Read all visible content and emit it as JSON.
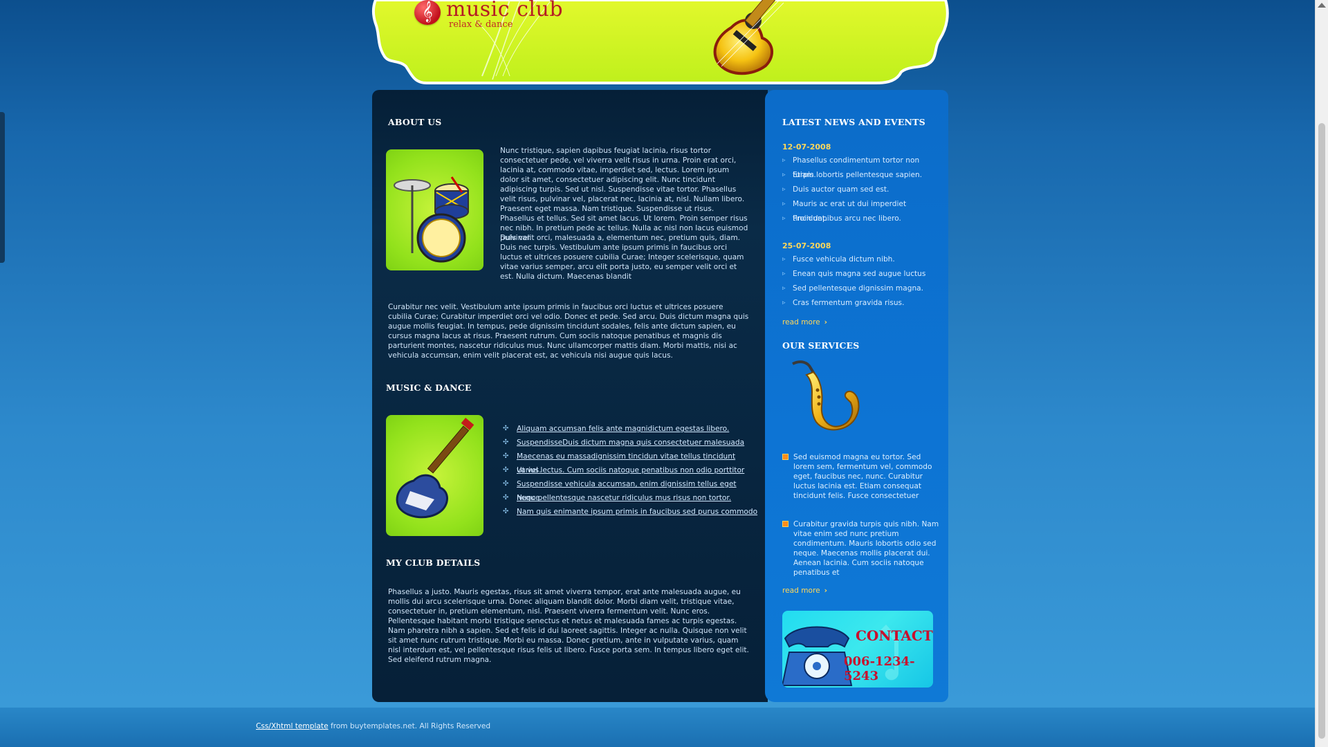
{
  "header": {
    "logo_glyph": "𝄞",
    "title": "music club",
    "tagline": "relax & dance"
  },
  "about": {
    "heading": "ABOUT US",
    "para1": "Nunc tristique, sapien dapibus feugiat lacinia, risus tortor consectetuer pede, vel viverra velit risus in urna. Proin erat orci, lacinia at, commodo vitae, imperdiet sed, lectus. Lorem ipsum dolor sit amet, consectetuer adipiscing elit. Nunc tincidunt adipiscing turpis. Sed ut nisl. Suspendisse vitae tortor. Phasellus velit risus, pulvinar vel, placerat nec, lacinia at, nisl. Nullam libero. Praesent eget massa. Nam tristique. Suspendisse ut risus. Phasellus et tellus. Sed sit amet lacus. Ut lorem. Proin semper risus nec nibh. In pretium pede ac tellus. Nulla ac nisl non lacus euismod pulvinar.",
    "para2": "Duis velit orci, malesuada a, elementum nec, pretium quis, diam. Duis nec turpis. Vestibulum ante ipsum primis in faucibus orci luctus et ultrices posuere cubilia Curae; Integer scelerisque, quam vitae varius semper, arcu elit porta justo, eu semper velit orci et est. Nulla dictum. Maecenas blandit",
    "para3": "Curabitur nec velit. Vestibulum ante ipsum primis in faucibus orci luctus et ultrices posuere cubilia Curae; Curabitur imperdiet orci vel odio. Donec et pede. Sed arcu. Duis dictum magna quis augue mollis feugiat. In tempus, pede dignissim tincidunt sodales, felis ante dictum sapien, eu cursus magna lacus at risus. Praesent rutrum. Cum sociis natoque penatibus et magnis dis parturient montes, nascetur ridiculus mus. Nunc ullamcorper mattis diam. Morbi mattis, nisi ac vehicula accumsan, enim velit placerat est, ac vehicula nisi augue quis lacus."
  },
  "music_dance": {
    "heading": "MUSIC & DANCE",
    "links": [
      "Aliquam accumsan felis ante magnidictum egestas libero.",
      "SuspendisseDuis dictum magna quis consectetuer malesuada",
      "Maecenas eu massadignissim tincidun vitae tellus tincidunt varius.",
      "Ut vel lectus. Cum sociis natoque penatibus non odio porttitor",
      "Suspendisse vehicula accumsan, enim dignissim tellus eget neque.",
      "Nunc pellentesque nascetur ridiculus mus risus non tortor.",
      "Nam quis enimante ipsum primis in faucibus sed purus commodo"
    ]
  },
  "club_details": {
    "heading": "MY CLUB DETAILS",
    "para": "Phasellus a justo. Mauris egestas, risus sit amet viverra tempor, erat ante malesuada augue, eu mollis dui arcu scelerisque urna. Donec aliquam blandit dolor. Morbi diam velit, tristique vitae, consectetuer in, pretium elementum, nisl. Praesent viverra fermentum velit. Nunc eros. Pellentesque habitant morbi tristique senectus et netus et malesuada fames ac turpis egestas. Nam pharetra nibh a sapien. Sed et felis id dui laoreet sagittis. Integer ac nulla. Quisque non velit sit amet nunc rutrum tristique. Morbi eu massa. Donec pretium, ante in vulputate varius, quam nisl interdum est, vel pellentesque risus felis ut libero. Fusce porta sem. In tempus libero eget elit. Sed eleifend rutrum magna."
  },
  "news": {
    "heading": "LATEST NEWS AND EVENTS",
    "groups": [
      {
        "date": "12-07-2008",
        "items": [
          "Phasellus condimentum tortor non turpis.",
          "Etiam lobortis pellentesque sapien.",
          "Duis auctor quam sed est.",
          "Mauris ac erat ut dui imperdiet tincidunt.",
          "Proin dapibus arcu nec libero."
        ]
      },
      {
        "date": "25-07-2008",
        "items": [
          "Fusce vehicula dictum nibh.",
          "Enean quis magna sed augue luctus",
          "Sed pellentesque dignissim magna.",
          "Cras fermentum gravida risus."
        ]
      }
    ],
    "read_more": "read more"
  },
  "services": {
    "heading": "OUR SERVICES",
    "items": [
      "Sed euismod magna eu tortor. Sed lorem sem, fermentum vel, commodo eget, faucibus nec, nunc. Curabitur luctus lacinia est. Etiam consequat tincidunt felis. Fusce consectetuer",
      "Curabitur gravida turpis quis nibh. Nam vitae enim sed nunc pretium condimentum. Mauris lobortis odio sed neque. Maecenas mollis placerat dui. Aenean lacinia. Cum sociis natoque penatibus et"
    ],
    "read_more": "read more"
  },
  "contact": {
    "title": "CONTACT",
    "phone": "006-1234-5243"
  },
  "footer": {
    "link_text": "Css/Xhtml template",
    "text": " from buytemplates.net. All Rights Reserved"
  },
  "colors": {
    "accent_yellow": "#ffd85a",
    "header_lime": "#d6f52a",
    "logo_red": "#b51b24"
  }
}
